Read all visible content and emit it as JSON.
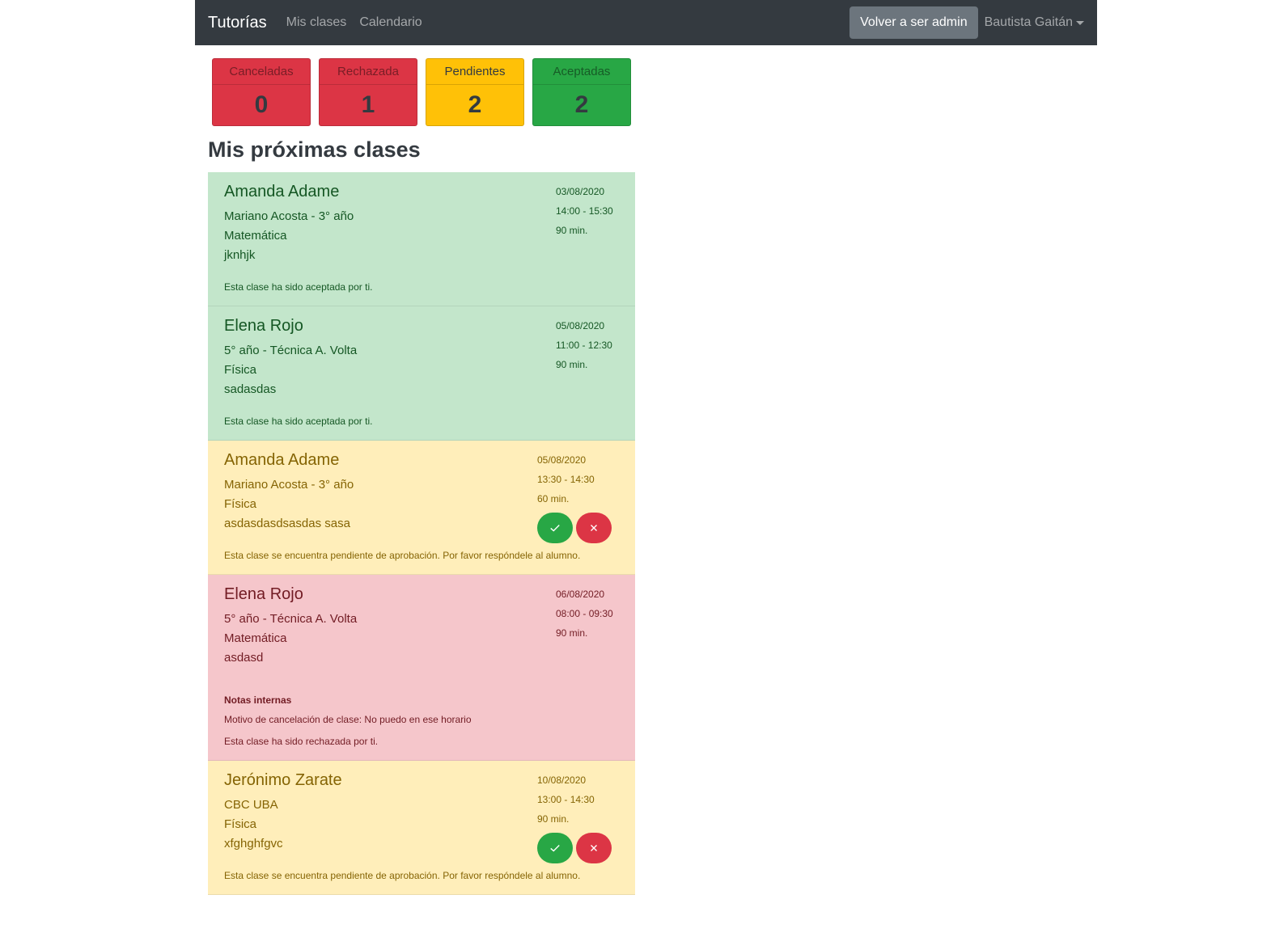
{
  "navbar": {
    "brand": "Tutorías",
    "links": [
      "Mis clases",
      "Calendario"
    ],
    "admin_button": "Volver a ser admin",
    "user": "Bautista Gaitán"
  },
  "stats": [
    {
      "label": "Canceladas",
      "value": "0",
      "color": "#dc3545"
    },
    {
      "label": "Rechazada",
      "value": "1",
      "color": "#dc3545"
    },
    {
      "label": "Pendientes",
      "value": "2",
      "color": "#ffc107"
    },
    {
      "label": "Aceptadas",
      "value": "2",
      "color": "#28a745"
    }
  ],
  "section_title": "Mis próximas clases",
  "classes": [
    {
      "status": "accepted",
      "name": "Amanda Adame",
      "school": "Mariano Acosta - 3° año",
      "subject": "Matemática",
      "notes": "jknhjk",
      "date": "03/08/2020",
      "time": "14:00 - 15:30",
      "duration": "90 min.",
      "status_text": "Esta clase ha sido aceptada por ti."
    },
    {
      "status": "accepted",
      "name": "Elena Rojo",
      "school": "5° año - Técnica A. Volta",
      "subject": "Física",
      "notes": "sadasdas",
      "date": "05/08/2020",
      "time": "11:00 - 12:30",
      "duration": "90 min.",
      "status_text": "Esta clase ha sido aceptada por ti."
    },
    {
      "status": "pending",
      "name": "Amanda Adame",
      "school": "Mariano Acosta - 3° año",
      "subject": "Física",
      "notes": "asdasdasdsasdas sasa",
      "date": "05/08/2020",
      "time": "13:30 - 14:30",
      "duration": "60 min.",
      "status_text": "Esta clase se encuentra pendiente de aprobación. Por favor respóndele al alumno."
    },
    {
      "status": "rejected",
      "name": "Elena Rojo",
      "school": "5° año - Técnica A. Volta",
      "subject": "Matemática",
      "notes": "asdasd",
      "date": "06/08/2020",
      "time": "08:00 - 09:30",
      "duration": "90 min.",
      "internal_notes_title": "Notas internas",
      "internal_notes": "Motivo de cancelación de clase: No puedo en ese horario",
      "status_text": "Esta clase ha sido rechazada por ti."
    },
    {
      "status": "pending",
      "name": "Jerónimo Zarate",
      "school": "CBC UBA",
      "subject": "Física",
      "notes": "xfghghfgvc",
      "date": "10/08/2020",
      "time": "13:00 - 14:30",
      "duration": "90 min.",
      "status_text": "Esta clase se encuentra pendiente de aprobación. Por favor respóndele al alumno."
    }
  ],
  "icons": {
    "accept": "check-icon",
    "reject": "close-icon"
  }
}
